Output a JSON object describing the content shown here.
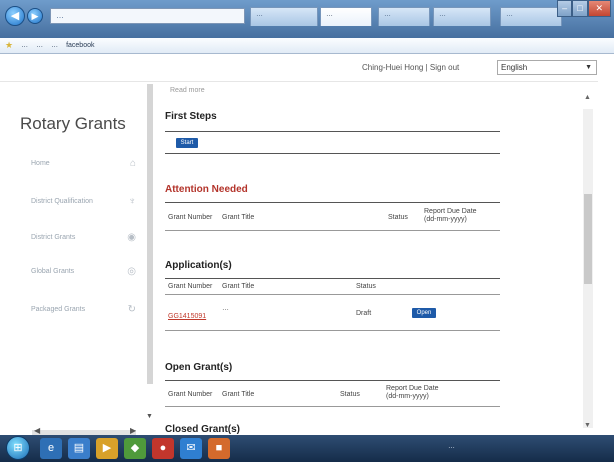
{
  "browser": {
    "address": "…",
    "tabs": [
      "…",
      "…",
      "…",
      "…",
      "…"
    ],
    "favorites": [
      "…",
      "…",
      "…",
      "facebook"
    ],
    "window_controls": [
      "–",
      "□",
      "✕"
    ]
  },
  "header": {
    "user_text": "Ching-Huei Hong | Sign out",
    "language": "English"
  },
  "sidebar": {
    "brand": "Rotary Grants",
    "items": [
      {
        "label": "Home",
        "icon": "home-icon",
        "glyph": "⌂"
      },
      {
        "label": "District Qualification",
        "icon": "trophy-icon",
        "glyph": "♆"
      },
      {
        "label": "District Grants",
        "icon": "circle-icon",
        "glyph": "◉"
      },
      {
        "label": "Global Grants",
        "icon": "globe-icon",
        "glyph": "◎"
      },
      {
        "label": "Packaged Grants",
        "icon": "refresh-icon",
        "glyph": "↻"
      }
    ],
    "footer": [
      "",
      "",
      ""
    ]
  },
  "main": {
    "read_more": "Read more",
    "first_steps": {
      "title": "First Steps",
      "button": "Start"
    },
    "attention": {
      "title": "Attention Needed",
      "columns": [
        "Grant Number",
        "Grant Title",
        "Status",
        "Report Due Date (dd-mm-yyyy)"
      ]
    },
    "applications": {
      "title": "Application(s)",
      "columns": [
        "Grant Number",
        "Grant Title",
        "Status"
      ],
      "rows": [
        {
          "number": "GG1415091",
          "title": "…",
          "status": "Draft",
          "action": "Open"
        }
      ]
    },
    "open_grants": {
      "title": "Open Grant(s)",
      "columns": [
        "Grant Number",
        "Grant Title",
        "Status",
        "Report Due Date (dd-mm-yyyy)"
      ]
    },
    "closed_grants": {
      "title": "Closed Grant(s)"
    }
  },
  "taskbar": {
    "tray_text": "…"
  },
  "colors": {
    "accent": "#1e5aa8",
    "attention": "#b3332a",
    "taskbar": "#1f3f66"
  }
}
